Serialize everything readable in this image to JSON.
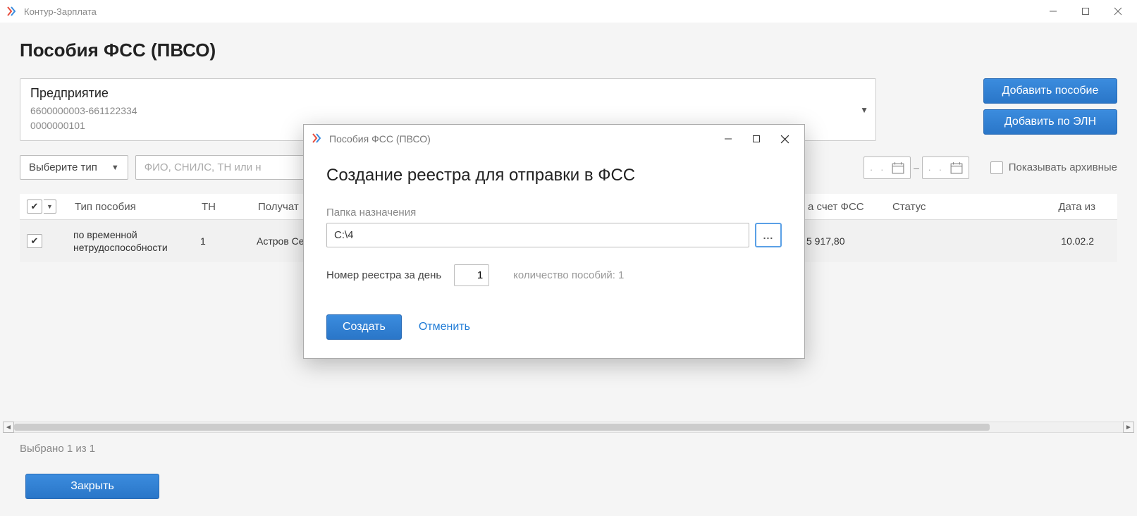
{
  "app": {
    "title": "Контур-Зарплата"
  },
  "page": {
    "title": "Пособия ФСС (ПВСО)"
  },
  "enterprise": {
    "label": "Предприятие",
    "line1": "6600000003-661122334",
    "line2": "0000000101"
  },
  "buttons": {
    "add_benefit": "Добавить пособие",
    "add_by_eln": "Добавить по ЭЛН",
    "close": "Закрыть"
  },
  "filters": {
    "type_placeholder": "Выберите тип",
    "search_placeholder": "ФИО, СНИЛС, ТН или н",
    "date_placeholder": " .  . ",
    "show_archive": "Показывать архивные"
  },
  "table": {
    "headers": {
      "type": "Тип пособия",
      "tn": "ТН",
      "recipient": "Получат",
      "fss": "а счет ФСС",
      "status": "Статус",
      "date": "Дата из"
    },
    "rows": [
      {
        "checked": true,
        "type": "по временной нетрудоспособности",
        "tn": "1",
        "recipient": "Астров Се",
        "fss_amount": "5 917,80",
        "status": "",
        "date": "10.02.2"
      }
    ]
  },
  "selection": "Выбрано 1 из 1",
  "modal": {
    "window_title": "Пособия ФСС (ПВСО)",
    "heading": "Создание реестра для отправки в ФСС",
    "folder_label": "Папка назначения",
    "folder_value": "C:\\4",
    "browse": "...",
    "reg_number_label": "Номер реестра за день",
    "reg_number_value": "1",
    "count_label": "количество пособий: 1",
    "create": "Создать",
    "cancel": "Отменить"
  }
}
